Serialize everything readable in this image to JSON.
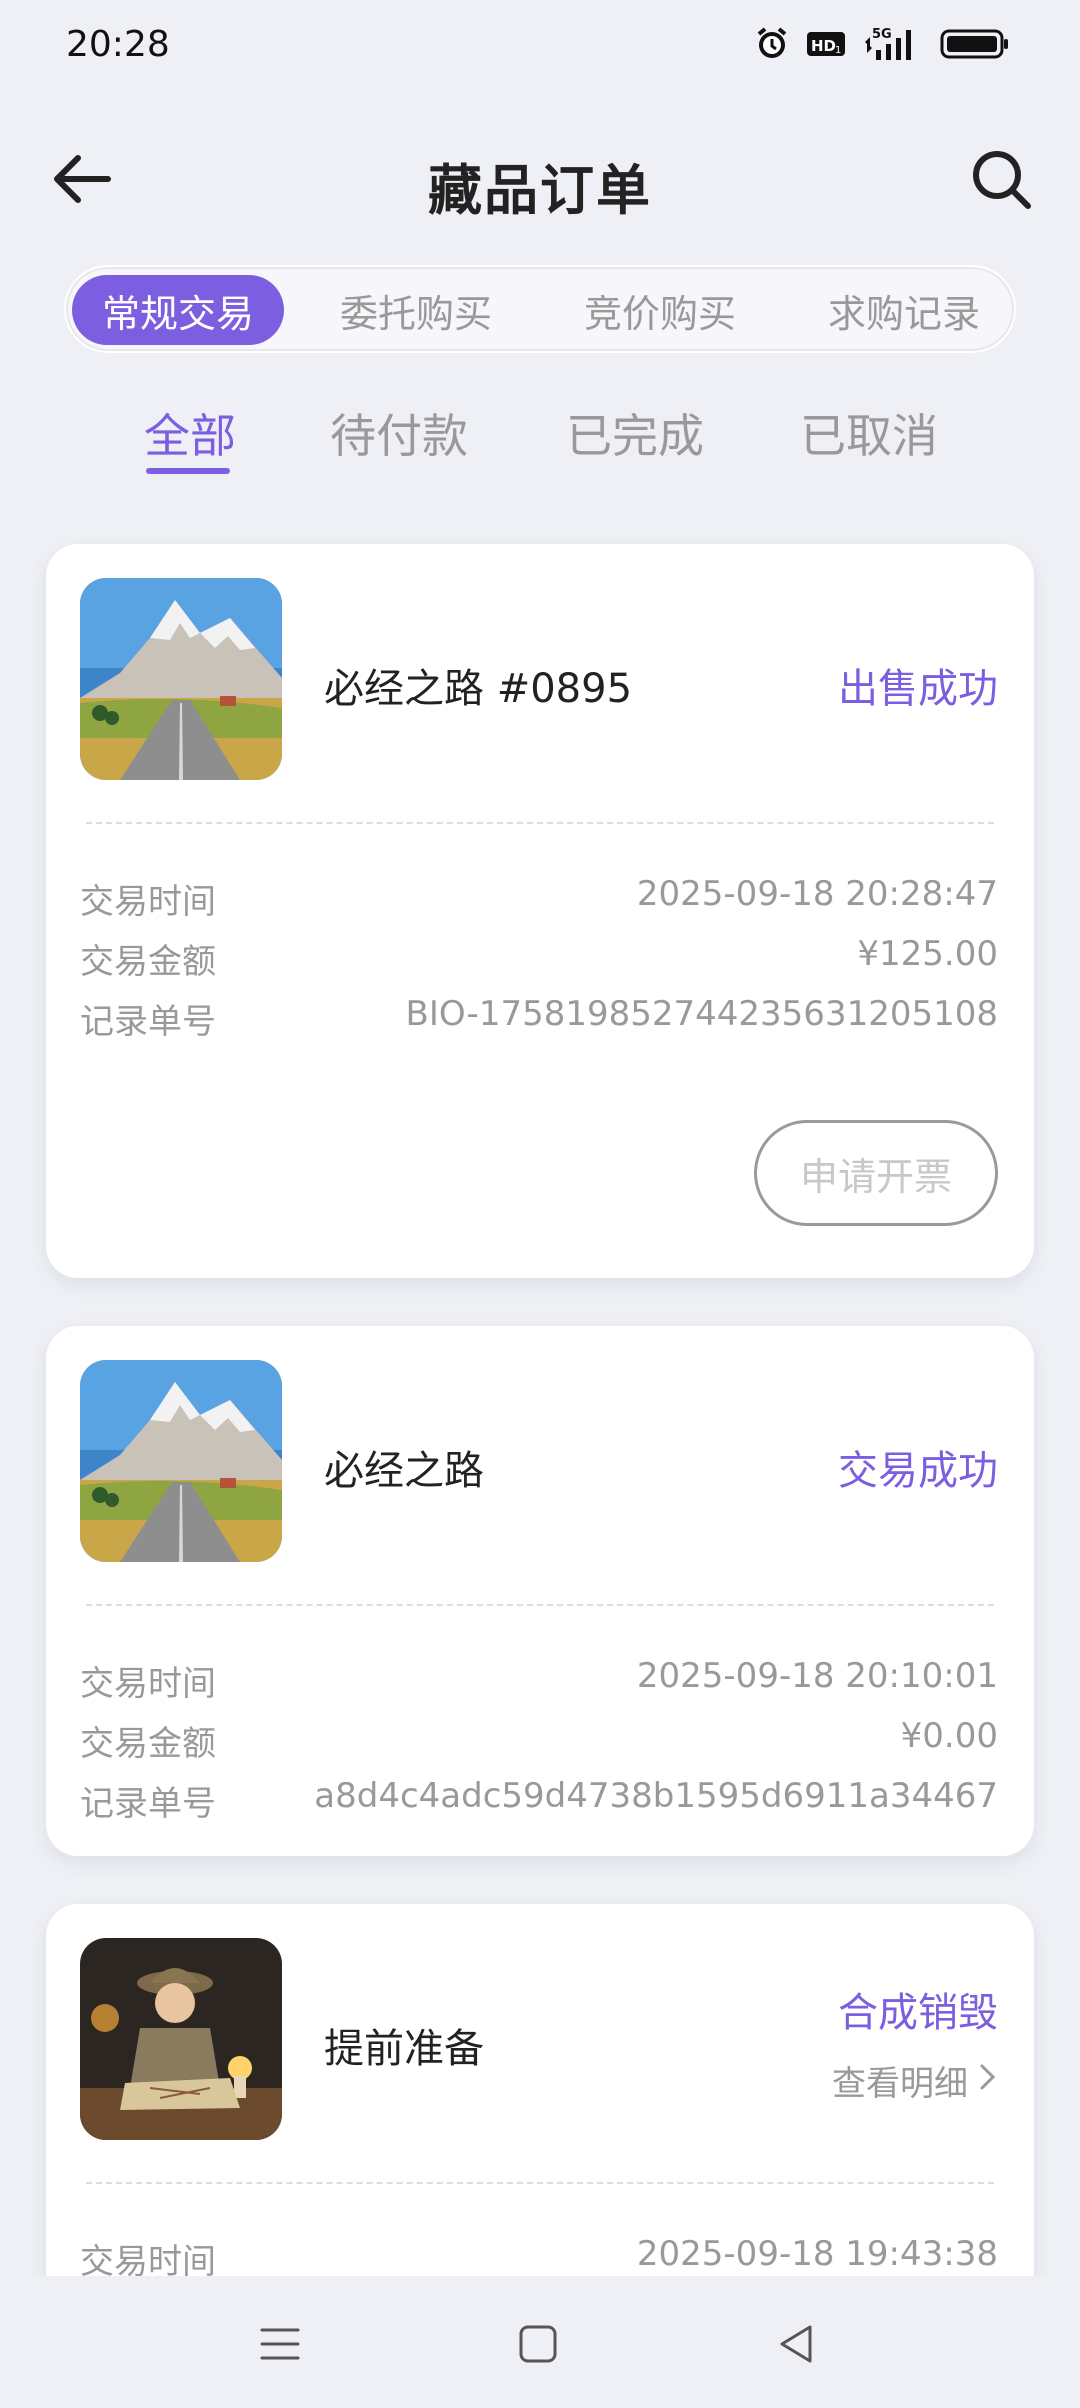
{
  "status_bar": {
    "time": "20:28",
    "icons": [
      "alarm-icon",
      "hd-icon",
      "5g-signal-icon",
      "battery-icon"
    ],
    "hd_label": "HD1",
    "network_label": "5G"
  },
  "header": {
    "title": "藏品订单",
    "back_icon": "arrow-left-icon",
    "search_icon": "search-icon"
  },
  "segments": [
    {
      "label": "常规交易",
      "active": true
    },
    {
      "label": "委托购买",
      "active": false
    },
    {
      "label": "竞价购买",
      "active": false
    },
    {
      "label": "求购记录",
      "active": false
    }
  ],
  "tabs": [
    {
      "label": "全部",
      "active": true
    },
    {
      "label": "待付款",
      "active": false
    },
    {
      "label": "已完成",
      "active": false
    },
    {
      "label": "已取消",
      "active": false
    }
  ],
  "orders": [
    {
      "name": "必经之路 #0895",
      "status": "出售成功",
      "rows": [
        {
          "label": "交易时间",
          "value": "2025-09-18 20:28:47"
        },
        {
          "label": "交易金额",
          "value": "¥125.00"
        },
        {
          "label": "记录单号",
          "value": "BIO-1758198527442356312051​08"
        }
      ],
      "action": "申请开票",
      "thumb": "mountain-road-image"
    },
    {
      "name": "必经之路",
      "status": "交易成功",
      "rows": [
        {
          "label": "交易时间",
          "value": "2025-09-18 20:10:01"
        },
        {
          "label": "交易金额",
          "value": "¥0.00"
        },
        {
          "label": "记录单号",
          "value": "a8d4c4adc59d4738b1595d6911a34467"
        }
      ],
      "thumb": "mountain-road-image"
    },
    {
      "name": "提前准备",
      "status": "合成销毁",
      "detail_link": "查看明细",
      "rows": [
        {
          "label": "交易时间",
          "value": "2025-09-18 19:43:38"
        }
      ],
      "thumb": "explorer-map-image"
    }
  ],
  "nav_bar": {
    "icons": [
      "menu-icon",
      "home-square-icon",
      "back-triangle-icon"
    ]
  },
  "colors": {
    "accent": "#7b5fe0",
    "background": "#eef0f5",
    "card": "#ffffff",
    "muted_text": "#999999"
  }
}
